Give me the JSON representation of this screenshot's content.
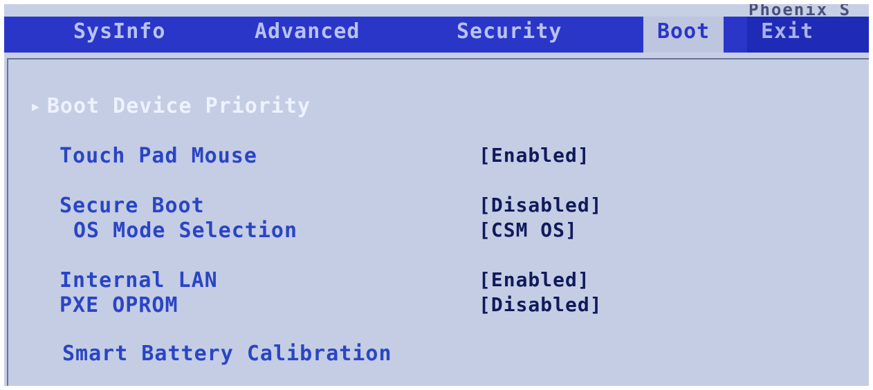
{
  "vendor_text": "Phoenix S",
  "tabs": [
    {
      "label": "SysInfo"
    },
    {
      "label": "Advanced"
    },
    {
      "label": "Security"
    },
    {
      "label": "Boot"
    },
    {
      "label": "Exit"
    }
  ],
  "active_tab": "Boot",
  "boot_menu": {
    "boot_device_priority": "Boot Device Priority",
    "touch_pad_mouse": {
      "label": "Touch Pad Mouse",
      "value": "[Enabled]"
    },
    "secure_boot": {
      "label": "Secure Boot",
      "value": "[Disabled]"
    },
    "os_mode_selection": {
      "label": "OS Mode Selection",
      "value": "[CSM OS]"
    },
    "internal_lan": {
      "label": "Internal LAN",
      "value": "[Enabled]"
    },
    "pxe_oprom": {
      "label": "PXE OPROM",
      "value": "[Disabled]"
    },
    "smart_battery_calibration": "Smart Battery Calibration"
  },
  "icons": {
    "submenu_arrow": "triangle-right-icon"
  },
  "colors": {
    "menubar": "#2a36c8",
    "active_tab_bg": "#bdc6de",
    "panel_bg": "#c4cde4",
    "item_text": "#2a45c4",
    "value_text": "#101a5a",
    "submenu_text": "#eef2ff"
  }
}
